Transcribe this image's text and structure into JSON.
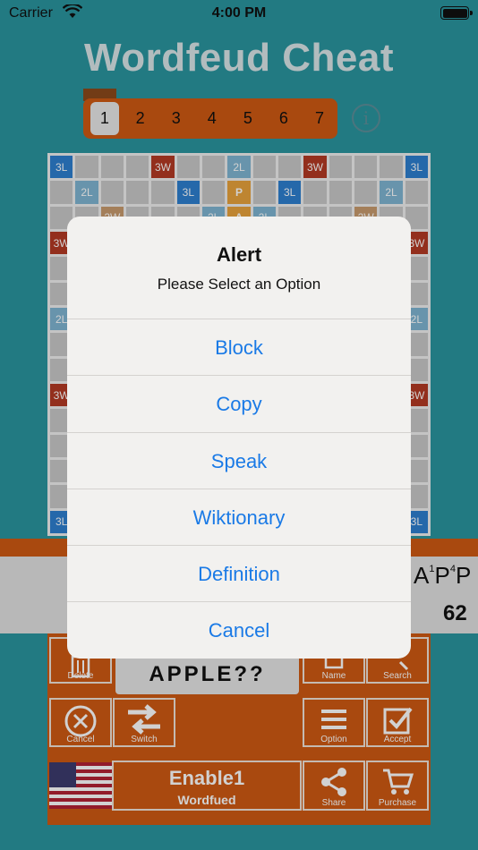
{
  "status_bar": {
    "carrier": "Carrier",
    "time": "4:00 PM"
  },
  "app_title": "Wordfeud Cheat",
  "player_selector": {
    "numbers": [
      "1",
      "2",
      "3",
      "4",
      "5",
      "6",
      "7"
    ],
    "selected": "1"
  },
  "board": {
    "rows": [
      [
        "3L",
        "",
        "",
        "",
        "3W",
        "",
        "",
        "2L",
        "",
        "",
        "3W",
        "",
        "",
        "",
        "3L"
      ],
      [
        "",
        "2L",
        "",
        "",
        "",
        "3L",
        "",
        "P",
        "",
        "3L",
        "",
        "",
        "",
        "2L",
        ""
      ],
      [
        "",
        "",
        "2W",
        "",
        "",
        "",
        "2L",
        "A",
        "2L",
        "",
        "",
        "",
        "2W",
        "",
        "",
        ""
      ],
      [
        "3W",
        "",
        "",
        "",
        "",
        "",
        "",
        "",
        "",
        "",
        "",
        "",
        "",
        "",
        "3W"
      ],
      [
        "",
        "",
        "",
        "",
        "",
        "",
        "",
        "",
        "",
        "",
        "",
        "",
        "",
        "",
        ""
      ],
      [
        "",
        "",
        "",
        "",
        "",
        "",
        "",
        "",
        "",
        "",
        "",
        "",
        "",
        "",
        ""
      ],
      [
        "2L",
        "",
        "",
        "",
        "",
        "",
        "",
        "",
        "",
        "",
        "",
        "",
        "",
        "",
        "2L"
      ],
      [
        "",
        "",
        "",
        "",
        "",
        "",
        "",
        "",
        "",
        "",
        "",
        "",
        "",
        "",
        ""
      ],
      [
        "",
        "",
        "",
        "",
        "",
        "",
        "",
        "",
        "",
        "",
        "",
        "",
        "",
        "",
        ""
      ],
      [
        "3W",
        "",
        "",
        "",
        "",
        "",
        "",
        "",
        "",
        "",
        "",
        "",
        "",
        "",
        "3W"
      ],
      [
        "",
        "",
        "",
        "",
        "",
        "",
        "",
        "",
        "",
        "",
        "",
        "",
        "",
        "",
        ""
      ],
      [
        "",
        "",
        "",
        "",
        "",
        "",
        "",
        "",
        "",
        "",
        "",
        "",
        "",
        "",
        ""
      ],
      [
        "",
        "",
        "",
        "",
        "",
        "",
        "",
        "",
        "",
        "",
        "",
        "",
        "",
        "",
        ""
      ],
      [
        "",
        "",
        "",
        "",
        "",
        "",
        "",
        "",
        "",
        "",
        "",
        "",
        "",
        "",
        ""
      ],
      [
        "3L",
        "",
        "",
        "",
        "",
        "",
        "",
        "",
        "",
        "",
        "",
        "",
        "",
        "",
        "3L"
      ]
    ],
    "tile_letter": "P",
    "tile_score": "4"
  },
  "word_display": {
    "letters": [
      {
        "char": "A",
        "score": "1"
      },
      {
        "char": "P",
        "score": "4"
      },
      {
        "char": "P",
        "score": ""
      }
    ],
    "score": "62"
  },
  "controls": {
    "delete": "Delete",
    "name": "Name",
    "search": "Search",
    "cancel": "Cancel",
    "switch": "Switch",
    "option": "Option",
    "accept": "Accept",
    "share": "Share",
    "purchase": "Purchase",
    "search_value": "APPLE??"
  },
  "dictionary": {
    "name": "Enable1",
    "sub": "Wordfued"
  },
  "alert": {
    "title": "Alert",
    "message": "Please Select an Option",
    "buttons": [
      "Block",
      "Copy",
      "Speak",
      "Wiktionary",
      "Definition",
      "Cancel"
    ]
  },
  "colors": {
    "background": "#2a959f",
    "orange": "#cf5a13",
    "triple_letter": "#2e7fd0",
    "double_letter": "#7fb5d2",
    "triple_word": "#b43a24",
    "double_word": "#c99c6e",
    "alert_button": "#1a7ae6"
  }
}
